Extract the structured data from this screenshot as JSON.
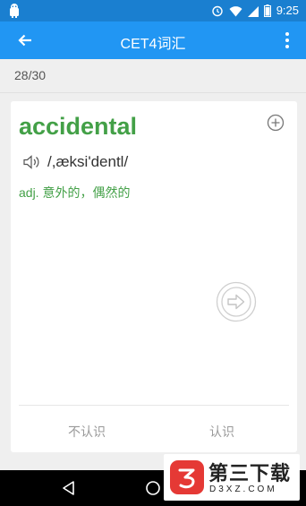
{
  "status_bar": {
    "time": "9:25",
    "icons": [
      "android-icon",
      "alarm-icon",
      "wifi-icon",
      "signal-icon",
      "battery-icon"
    ]
  },
  "app_bar": {
    "title": "CET4词汇",
    "back_icon": "arrow-back-icon",
    "menu_icon": "more-vert-icon"
  },
  "progress": {
    "text": "28/30",
    "current": 28,
    "total": 30
  },
  "card": {
    "word": "accidental",
    "phonetic": "/,æksi'dentl/",
    "meaning": "adj. 意外的，偶然的",
    "add_icon": "add-circle-icon",
    "speaker_icon": "speaker-icon",
    "next_icon": "next-arrow-icon",
    "unknown_label": "不认识",
    "known_label": "认识"
  },
  "nav_bar": {
    "icons": [
      "nav-back-icon",
      "nav-home-icon"
    ]
  },
  "watermark": {
    "title": "第三下载",
    "subtitle": "D3XZ.COM"
  },
  "colors": {
    "status_bar": "#1a7fd0",
    "app_bar": "#2196f3",
    "accent_green": "#43a047",
    "watermark_red": "#e53935"
  }
}
